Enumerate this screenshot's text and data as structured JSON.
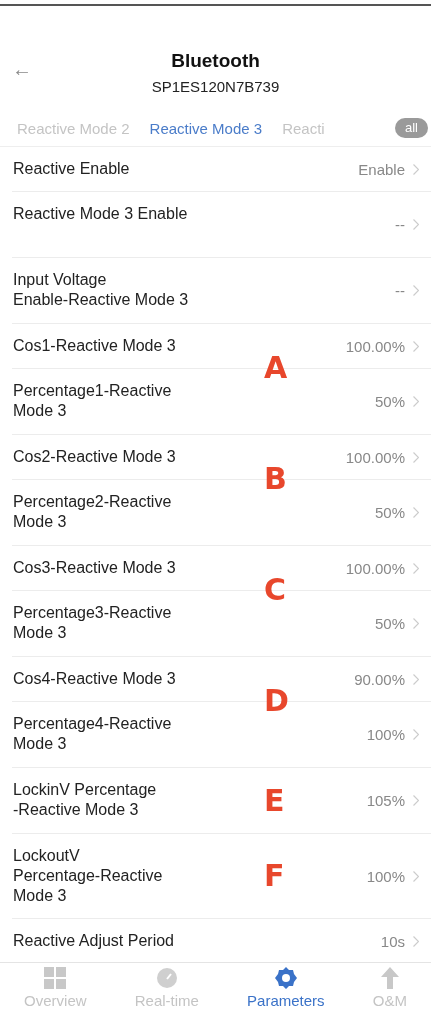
{
  "header": {
    "back": "←",
    "title": "Bluetooth",
    "subtitle": "SP1ES120N7B739"
  },
  "tabs": [
    {
      "label": "Reactive Mode 2",
      "selected": false
    },
    {
      "label": "Reactive Mode 3",
      "selected": true
    },
    {
      "label": "Reacti",
      "selected": false
    }
  ],
  "all_button": "all",
  "rows": [
    {
      "label": "Reactive Enable",
      "value": "Enable",
      "kind": "compact"
    },
    {
      "label": "Reactive Mode 3 Enable",
      "value": "--",
      "kind": "tall"
    },
    {
      "label": "Input Voltage\nEnable-Reactive Mode 3",
      "value": "--",
      "kind": "tall"
    },
    {
      "label": "Cos1-Reactive Mode 3",
      "value": "100.00%",
      "kind": "compact",
      "annotation": "A"
    },
    {
      "label": "Percentage1-Reactive\nMode 3",
      "value": "50%",
      "kind": "tall"
    },
    {
      "label": "Cos2-Reactive Mode 3",
      "value": "100.00%",
      "kind": "compact",
      "annotation": "B"
    },
    {
      "label": "Percentage2-Reactive\nMode 3",
      "value": "50%",
      "kind": "tall"
    },
    {
      "label": "Cos3-Reactive Mode 3",
      "value": "100.00%",
      "kind": "compact",
      "annotation": "C"
    },
    {
      "label": "Percentage3-Reactive\nMode 3",
      "value": "50%",
      "kind": "tall"
    },
    {
      "label": "Cos4-Reactive Mode 3",
      "value": "90.00%",
      "kind": "compact",
      "annotation": "D"
    },
    {
      "label": "Percentage4-Reactive\nMode 3",
      "value": "100%",
      "kind": "tall"
    },
    {
      "label": "LockinV Percentage\n-Reactive Mode 3",
      "value": "105%",
      "kind": "tall",
      "annotation": "E"
    },
    {
      "label": "LockoutV\nPercentage-Reactive\nMode 3",
      "value": "100%",
      "kind": "tall",
      "annotation": "F"
    },
    {
      "label": "Reactive Adjust Period",
      "value": "10s",
      "kind": "compact"
    }
  ],
  "nav": [
    {
      "label": "Overview",
      "kind": "grid",
      "selected": false
    },
    {
      "label": "Real-time",
      "kind": "gauge",
      "selected": false
    },
    {
      "label": "Parameters",
      "kind": "gear",
      "selected": true
    },
    {
      "label": "O&M",
      "kind": "arrow",
      "selected": false
    }
  ]
}
